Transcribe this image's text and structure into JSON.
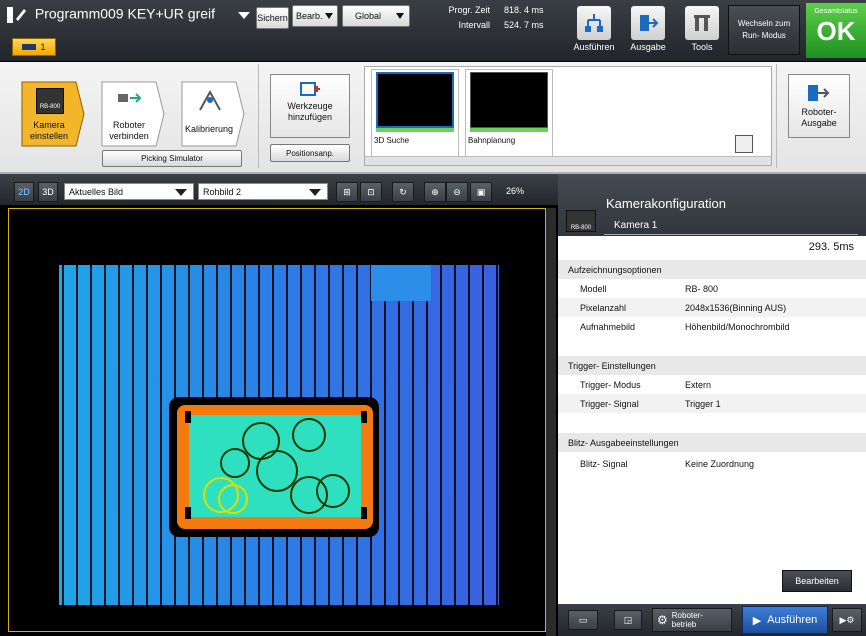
{
  "header": {
    "program": "Programm009  KEY+UR  greif",
    "save": "Sichern",
    "edit": "Bearb.",
    "scope": "Global",
    "tab_label": "1",
    "stats": [
      {
        "label": "Progr. Zeit",
        "value": "818. 4  ms"
      },
      {
        "label": "Intervall",
        "value": "524. 7  ms"
      }
    ],
    "tools": [
      "Ausführen",
      "Ausgabe",
      "Tools"
    ],
    "switch": "Wechseln  zum\nRun- Modus",
    "total_status_label": "Gesamtstatus",
    "total_status": "OK",
    "colors": {
      "ok": "#2fa52b",
      "accent": "#f2a600"
    }
  },
  "ribbon": {
    "steps": [
      {
        "label": "Kamera\neinstellen",
        "badge": "RB-800"
      },
      {
        "label": "Roboter\nverbinden"
      },
      {
        "label": "Kalibrierung"
      }
    ],
    "picking_sim": "Picking  Simulator",
    "add_tools": "Werkzeuge\nhinzufügen",
    "pos_adjust": "Positionsanp.",
    "thumbnails": [
      {
        "name": "3D  Suche"
      },
      {
        "name": "Bahnplanung"
      }
    ],
    "robot_output": "Roboter-\nAusgabe"
  },
  "viewer": {
    "mode_2d": "2D",
    "mode_3d": "3D",
    "image_source": "Aktuelles  Bild",
    "image_type": "Rohbild  2",
    "zoom": "26%"
  },
  "panel": {
    "title": "Kamerakonfiguration",
    "camera": "Kamera   1",
    "badge": "RB-800",
    "time": "293. 5ms",
    "sections": [
      {
        "title": "Aufzeichnungsoptionen",
        "rows": [
          {
            "k": "Modell",
            "v": "RB- 800"
          },
          {
            "k": "Pixelanzahl",
            "v": "2048x1536(Binning  AUS)"
          },
          {
            "k": "Aufnahmebild",
            "v": "Höhenbild/Monochrombild"
          }
        ]
      },
      {
        "title": "Trigger-  Einstellungen",
        "rows": [
          {
            "k": "Trigger-  Modus",
            "v": "Extern"
          },
          {
            "k": "Trigger-  Signal",
            "v": "Trigger   1"
          }
        ]
      },
      {
        "title": "Blitz-  Ausgabeeinstellungen",
        "rows": [
          {
            "k": "Blitz-  Signal",
            "v": "Keine  Zuordnung"
          }
        ]
      }
    ],
    "edit": "Bearbeiten"
  },
  "bottom": {
    "robot_op": "Roboter-\nbetrieb",
    "run": "Ausführen"
  }
}
